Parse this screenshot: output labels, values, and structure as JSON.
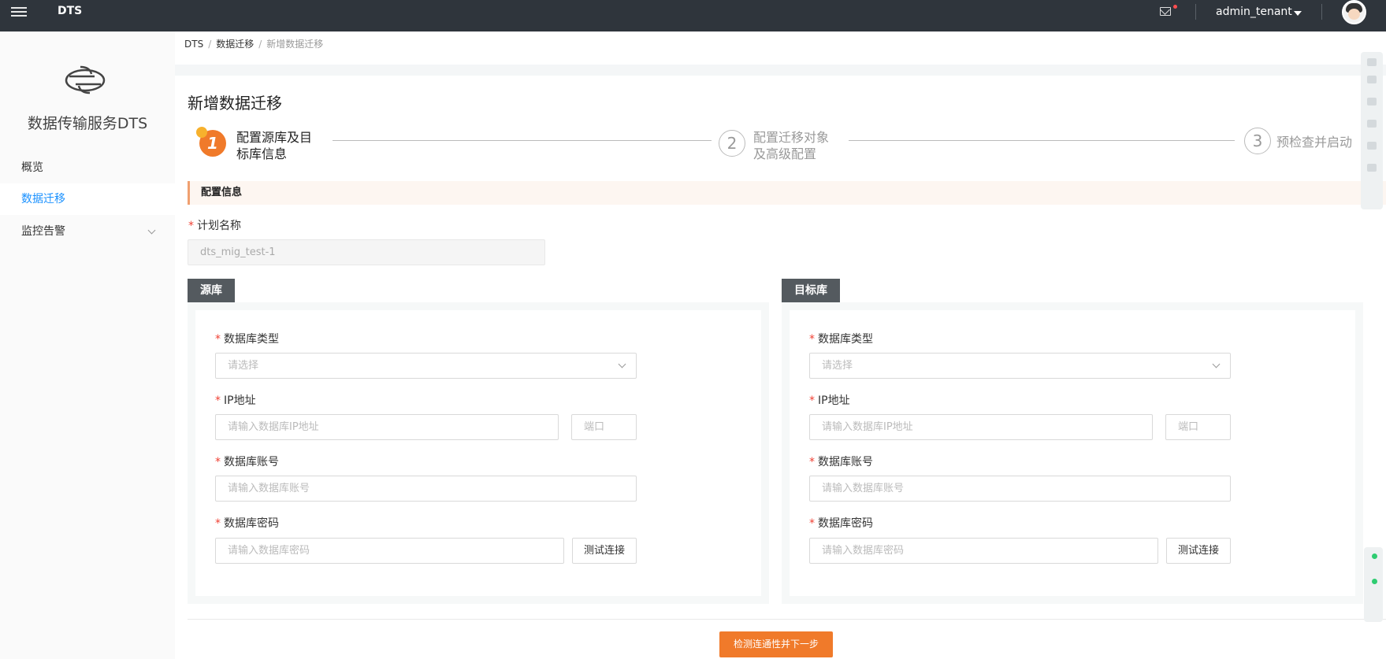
{
  "topbar": {
    "brand": "DTS",
    "username": "admin_tenant"
  },
  "sidebar": {
    "title": "数据传输服务DTS",
    "items": [
      {
        "label": "概览"
      },
      {
        "label": "数据迁移"
      },
      {
        "label": "监控告警"
      }
    ]
  },
  "breadcrumb": {
    "items": [
      "DTS",
      "数据迁移",
      "新增数据迁移"
    ]
  },
  "page": {
    "title": "新增数据迁移"
  },
  "steps": [
    {
      "num": "1",
      "line1": "配置源库及目",
      "line2": "标库信息"
    },
    {
      "num": "2",
      "line1": "配置迁移对象",
      "line2": "及高级配置"
    },
    {
      "num": "3",
      "line1": "预检查并启动"
    }
  ],
  "section": {
    "title": "配置信息",
    "plan_label": "计划名称",
    "plan_value": "dts_mig_test-1"
  },
  "source": {
    "tag": "源库",
    "db_type_label": "数据库类型",
    "db_type_placeholder": "请选择",
    "ip_label": "IP地址",
    "ip_placeholder": "请输入数据库IP地址",
    "port_placeholder": "端口",
    "account_label": "数据库账号",
    "account_placeholder": "请输入数据库账号",
    "password_label": "数据库密码",
    "password_placeholder": "请输入数据库密码",
    "test_button": "测试连接"
  },
  "target": {
    "tag": "目标库",
    "db_type_label": "数据库类型",
    "db_type_placeholder": "请选择",
    "ip_label": "IP地址",
    "ip_placeholder": "请输入数据库IP地址",
    "port_placeholder": "端口",
    "account_label": "数据库账号",
    "account_placeholder": "请输入数据库账号",
    "password_label": "数据库密码",
    "password_placeholder": "请输入数据库密码",
    "test_button": "测试连接"
  },
  "footer": {
    "next_button": "检测连通性并下一步"
  },
  "colors": {
    "topbar": "#2f353c",
    "accent": "#f07a2a",
    "link": "#1890ff",
    "required": "#f04134"
  }
}
